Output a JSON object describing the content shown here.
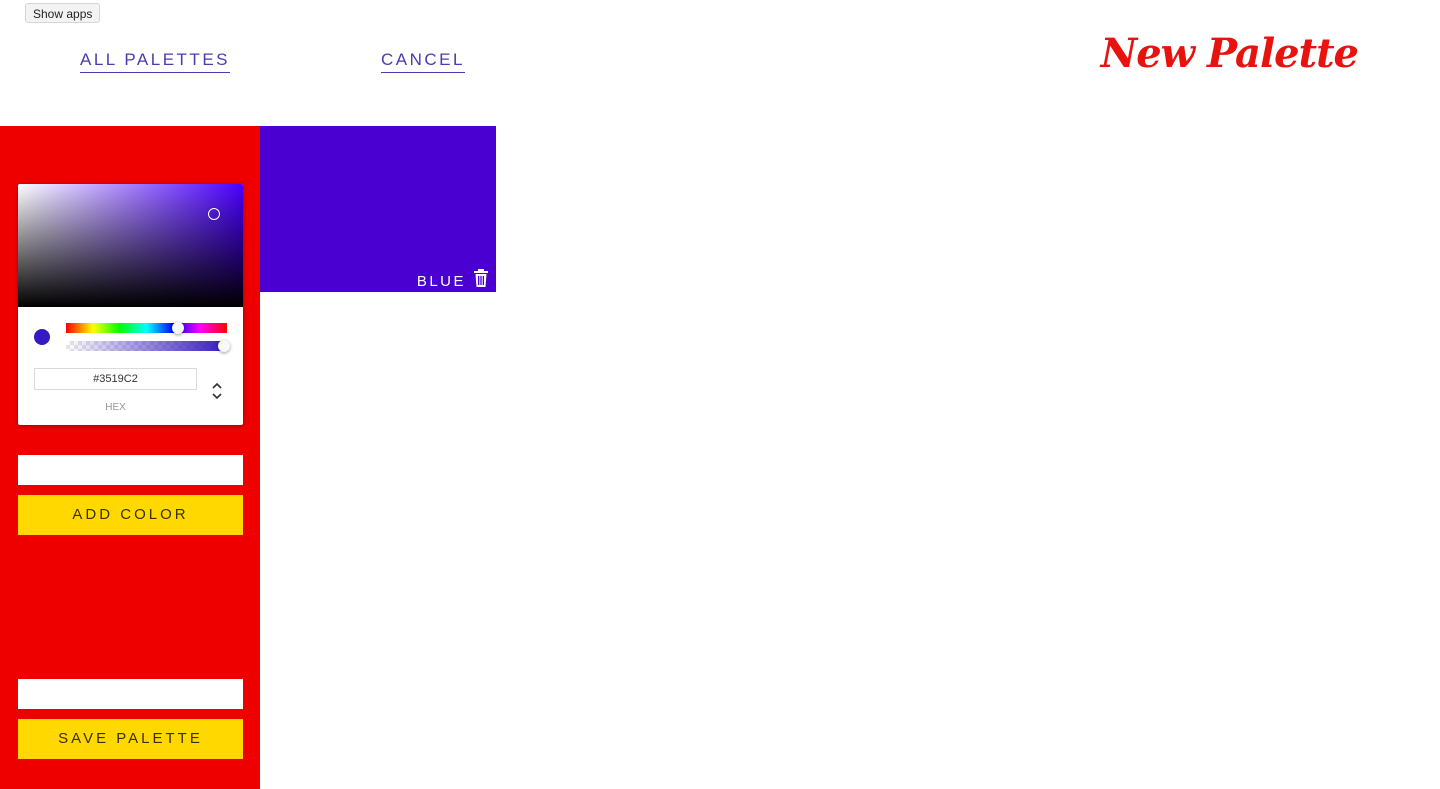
{
  "system": {
    "show_apps_label": "Show apps"
  },
  "nav": {
    "all_palettes_label": "ALL PALETTES",
    "cancel_label": "CANCEL"
  },
  "header": {
    "title": "New Palette"
  },
  "colors": {
    "sidebar_bg": "#ee0000",
    "title_color": "#e8120e",
    "button_bg": "#ffd800",
    "link_color": "#4b3bb0"
  },
  "color_picker": {
    "hex_value": "#3519C2",
    "hex_label": "HEX",
    "current_color": "#3519C2",
    "hue_icon": "hue-slider",
    "alpha_icon": "alpha-slider",
    "format_toggle_icon": "chevron-up-down-icon"
  },
  "form": {
    "color_name_value": "",
    "palette_name_value": "",
    "add_color_label": "ADD COLOR",
    "save_palette_label": "SAVE PALETTE"
  },
  "palette": {
    "boxes": [
      {
        "name": "BLUE",
        "color": "#4a00d0",
        "delete_icon": "trash-icon"
      }
    ]
  }
}
